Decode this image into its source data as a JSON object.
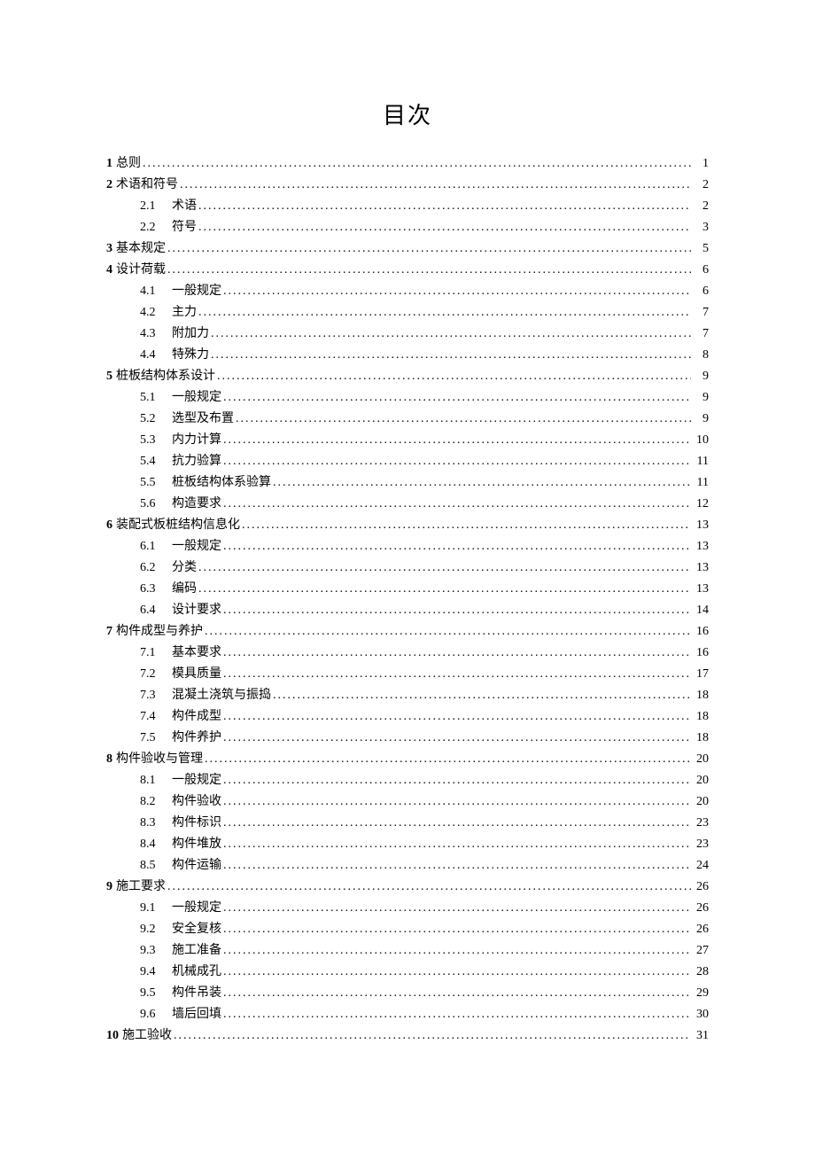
{
  "title": "目次",
  "toc": [
    {
      "level": 1,
      "num": "1",
      "label": "总则",
      "page": "1"
    },
    {
      "level": 1,
      "num": "2",
      "label": "术语和符号",
      "page": "2"
    },
    {
      "level": 2,
      "num": "2.1",
      "label": "术语",
      "page": "2"
    },
    {
      "level": 2,
      "num": "2.2",
      "label": "符号",
      "page": "3"
    },
    {
      "level": 1,
      "num": "3",
      "label": "基本规定",
      "page": "5"
    },
    {
      "level": 1,
      "num": "4",
      "label": "设计荷载",
      "page": "6"
    },
    {
      "level": 2,
      "num": "4.1",
      "label": "一般规定",
      "page": "6"
    },
    {
      "level": 2,
      "num": "4.2",
      "label": "主力",
      "page": "7"
    },
    {
      "level": 2,
      "num": "4.3",
      "label": "附加力",
      "page": "7"
    },
    {
      "level": 2,
      "num": "4.4",
      "label": "特殊力",
      "page": "8"
    },
    {
      "level": 1,
      "num": "5",
      "label": "桩板结构体系设计",
      "page": "9"
    },
    {
      "level": 2,
      "num": "5.1",
      "label": "一般规定",
      "page": "9"
    },
    {
      "level": 2,
      "num": "5.2",
      "label": "选型及布置",
      "page": "9"
    },
    {
      "level": 2,
      "num": "5.3",
      "label": "内力计算",
      "page": "10"
    },
    {
      "level": 2,
      "num": "5.4",
      "label": "抗力验算",
      "page": "11"
    },
    {
      "level": 2,
      "num": "5.5",
      "label": "桩板结构体系验算",
      "page": "11"
    },
    {
      "level": 2,
      "num": "5.6",
      "label": "构造要求",
      "page": "12"
    },
    {
      "level": 1,
      "num": "6",
      "label": "装配式板桩结构信息化",
      "page": "13"
    },
    {
      "level": 2,
      "num": "6.1",
      "label": "一般规定",
      "page": "13"
    },
    {
      "level": 2,
      "num": "6.2",
      "label": "分类",
      "page": "13"
    },
    {
      "level": 2,
      "num": "6.3",
      "label": "编码",
      "page": "13"
    },
    {
      "level": 2,
      "num": "6.4",
      "label": "设计要求",
      "page": "14"
    },
    {
      "level": 1,
      "num": "7",
      "label": "构件成型与养护",
      "page": "16"
    },
    {
      "level": 2,
      "num": "7.1",
      "label": "基本要求",
      "page": "16"
    },
    {
      "level": 2,
      "num": "7.2",
      "label": "模具质量",
      "page": "17"
    },
    {
      "level": 2,
      "num": "7.3",
      "label": "混凝土浇筑与振捣",
      "page": "18"
    },
    {
      "level": 2,
      "num": "7.4",
      "label": "构件成型",
      "page": "18"
    },
    {
      "level": 2,
      "num": "7.5",
      "label": "构件养护",
      "page": "18"
    },
    {
      "level": 1,
      "num": "8",
      "label": "构件验收与管理",
      "page": "20"
    },
    {
      "level": 2,
      "num": "8.1",
      "label": "一般规定",
      "page": "20"
    },
    {
      "level": 2,
      "num": "8.2",
      "label": "构件验收",
      "page": "20"
    },
    {
      "level": 2,
      "num": "8.3",
      "label": "构件标识",
      "page": "23"
    },
    {
      "level": 2,
      "num": "8.4",
      "label": "构件堆放",
      "page": "23"
    },
    {
      "level": 2,
      "num": "8.5",
      "label": "构件运输",
      "page": "24"
    },
    {
      "level": 1,
      "num": "9",
      "label": "施工要求",
      "page": "26"
    },
    {
      "level": 2,
      "num": "9.1",
      "label": "一般规定",
      "page": "26"
    },
    {
      "level": 2,
      "num": "9.2",
      "label": "安全复核",
      "page": "26"
    },
    {
      "level": 2,
      "num": "9.3",
      "label": "施工准备",
      "page": "27"
    },
    {
      "level": 2,
      "num": "9.4",
      "label": "机械成孔",
      "page": "28"
    },
    {
      "level": 2,
      "num": "9.5",
      "label": "构件吊装",
      "page": "29"
    },
    {
      "level": 2,
      "num": "9.6",
      "label": "墙后回填",
      "page": "30"
    },
    {
      "level": 1,
      "num": "10",
      "label": "施工验收",
      "page": "31"
    }
  ]
}
